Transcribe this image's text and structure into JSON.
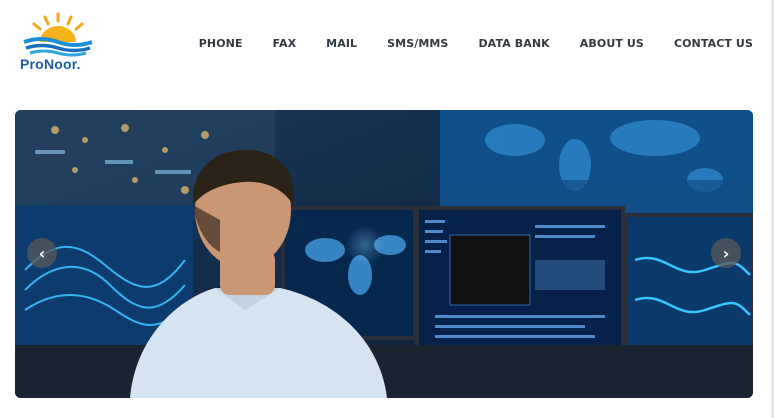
{
  "brand": {
    "name": "ProNoor."
  },
  "nav": {
    "items": [
      {
        "label": "PHONE"
      },
      {
        "label": "FAX"
      },
      {
        "label": "MAIL"
      },
      {
        "label": "SMS/MMS"
      },
      {
        "label": "DATA BANK"
      },
      {
        "label": "ABOUT US"
      },
      {
        "label": "CONTACT US"
      }
    ]
  },
  "slider": {
    "prev_icon": "chevron-left-icon",
    "next_icon": "chevron-right-icon",
    "prev_glyph": "‹",
    "next_glyph": "›"
  },
  "colors": {
    "brand_blue": "#1d5fa6",
    "sun_orange": "#f5a623",
    "nav_text": "#333a44"
  }
}
